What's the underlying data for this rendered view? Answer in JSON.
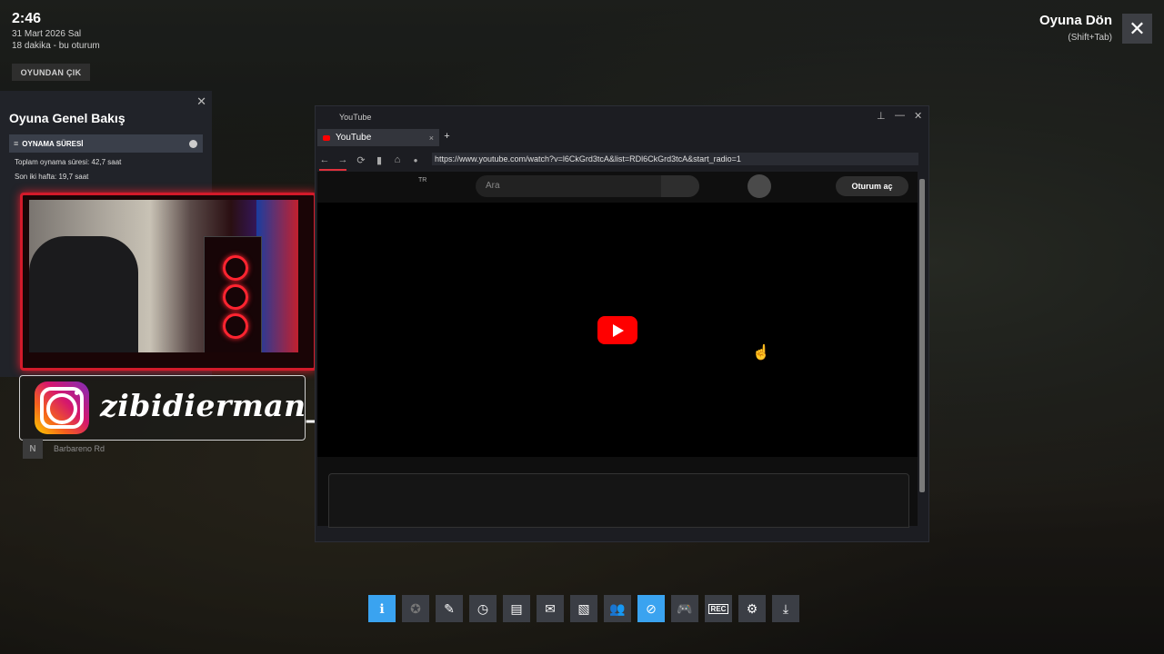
{
  "clock": {
    "time": "2:46",
    "date": "31 Mart 2026 Sal",
    "session": "18 dakika - bu oturum",
    "exit_label": "OYUNDAN ÇIK"
  },
  "return": {
    "title": "Oyuna Dön",
    "shortcut": "(Shift+Tab)",
    "close_glyph": "✕"
  },
  "overview": {
    "title": "Oyuna Genel Bakış",
    "close_glyph": "✕",
    "section": "OYNAMA SÜRESİ",
    "total": "Toplam oynama süresi: 42,7 saat",
    "two_weeks": "Son iki hafta: 19,7 saat"
  },
  "instagram": {
    "handle": "zibidierman_"
  },
  "road": {
    "badge": "N",
    "name": "Barbareno Rd"
  },
  "browser": {
    "window_title": "YouTube",
    "tab_label": "YouTube",
    "tab_close": "×",
    "new_tab": "+",
    "url": "https://www.youtube.com/watch?v=l6CkGrd3tcA&list=RDl6CkGrd3tcA&start_radio=1",
    "pin_glyph": "📌",
    "min_glyph": "—",
    "close_glyph": "✕",
    "nav": {
      "back": "←",
      "forward": "→",
      "reload": "⟳",
      "bookmark": "▮",
      "home": "⌂",
      "lock": "🔒"
    }
  },
  "youtube": {
    "region": "TR",
    "search_placeholder": "Ara",
    "signin": "Oturum aç"
  },
  "toolbar": {
    "items": [
      {
        "name": "info-icon",
        "glyph": "ℹ"
      },
      {
        "name": "achievements-icon",
        "glyph": "✪"
      },
      {
        "name": "notes-icon",
        "glyph": "✎"
      },
      {
        "name": "recent-icon",
        "glyph": "◷"
      },
      {
        "name": "guides-icon",
        "glyph": "▤"
      },
      {
        "name": "chat-icon",
        "glyph": "✉"
      },
      {
        "name": "screenshots-icon",
        "glyph": "▧"
      },
      {
        "name": "friends-icon",
        "glyph": "👥"
      },
      {
        "name": "browser-icon",
        "glyph": "⊘"
      },
      {
        "name": "controller-icon",
        "glyph": "🎮"
      },
      {
        "name": "recording-icon",
        "glyph": "REC"
      },
      {
        "name": "settings-icon",
        "glyph": "⚙"
      },
      {
        "name": "download-icon",
        "glyph": "⤓"
      }
    ]
  },
  "colors": {
    "accent": "#3aa3f0",
    "youtube_red": "#ff0000",
    "cam_border": "#d31a2a"
  }
}
